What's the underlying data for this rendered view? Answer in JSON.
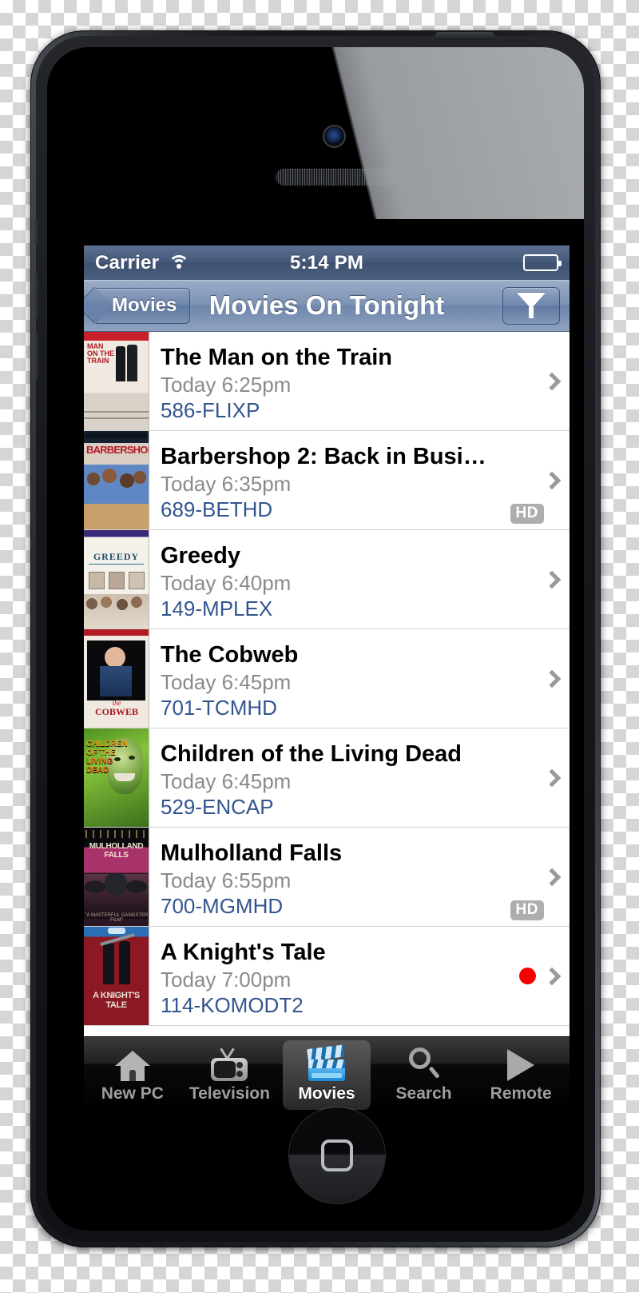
{
  "device": {
    "type": "smartphone",
    "icons": {
      "camera": "camera-icon",
      "speaker": "speaker-grille-icon",
      "home": "home-button-icon"
    }
  },
  "status_bar": {
    "carrier": "Carrier",
    "wifi_icon": "wifi-icon",
    "time": "5:14 PM",
    "battery_icon": "battery-icon"
  },
  "nav_bar": {
    "back_label": "Movies",
    "title": "Movies On Tonight",
    "filter_icon": "funnel-icon"
  },
  "list": {
    "items": [
      {
        "title": "The Man on the Train",
        "time": "Today 6:25pm",
        "channel": "586-FLIXP",
        "hd": false,
        "recording": false,
        "poster_alt": "man-on-the-train-poster"
      },
      {
        "title": "Barbershop 2: Back in Busi…",
        "time": "Today 6:35pm",
        "channel": "689-BETHD",
        "hd": true,
        "recording": false,
        "poster_alt": "barbershop-2-poster"
      },
      {
        "title": "Greedy",
        "time": "Today 6:40pm",
        "channel": "149-MPLEX",
        "hd": false,
        "recording": false,
        "poster_alt": "greedy-poster"
      },
      {
        "title": "The Cobweb",
        "time": "Today 6:45pm",
        "channel": "701-TCMHD",
        "hd": false,
        "recording": false,
        "poster_alt": "the-cobweb-poster"
      },
      {
        "title": "Children of the Living Dead",
        "time": "Today 6:45pm",
        "channel": "529-ENCAP",
        "hd": false,
        "recording": false,
        "poster_alt": "children-of-the-living-dead-poster"
      },
      {
        "title": "Mulholland Falls",
        "time": "Today 6:55pm",
        "channel": "700-MGMHD",
        "hd": true,
        "recording": false,
        "poster_alt": "mulholland-falls-poster"
      },
      {
        "title": "A Knight's Tale",
        "time": "Today 7:00pm",
        "channel": "114-KOMODT2",
        "hd": false,
        "recording": true,
        "poster_alt": "a-knights-tale-poster"
      }
    ],
    "hd_badge_label": "HD"
  },
  "tab_bar": {
    "tabs": [
      {
        "label": "New PC",
        "icon": "house-icon",
        "selected": false
      },
      {
        "label": "Television",
        "icon": "tv-icon",
        "selected": false
      },
      {
        "label": "Movies",
        "icon": "clapper-icon",
        "selected": true
      },
      {
        "label": "Search",
        "icon": "search-icon",
        "selected": false
      },
      {
        "label": "Remote",
        "icon": "play-icon",
        "selected": false
      }
    ]
  },
  "colors": {
    "nav_blue": "#6e86ac",
    "status_blue": "#47597a",
    "channel_link": "#33558f",
    "record_red": "#f50000",
    "hd_gray": "#aeaeae",
    "tab_selected_text": "#ffffff"
  }
}
